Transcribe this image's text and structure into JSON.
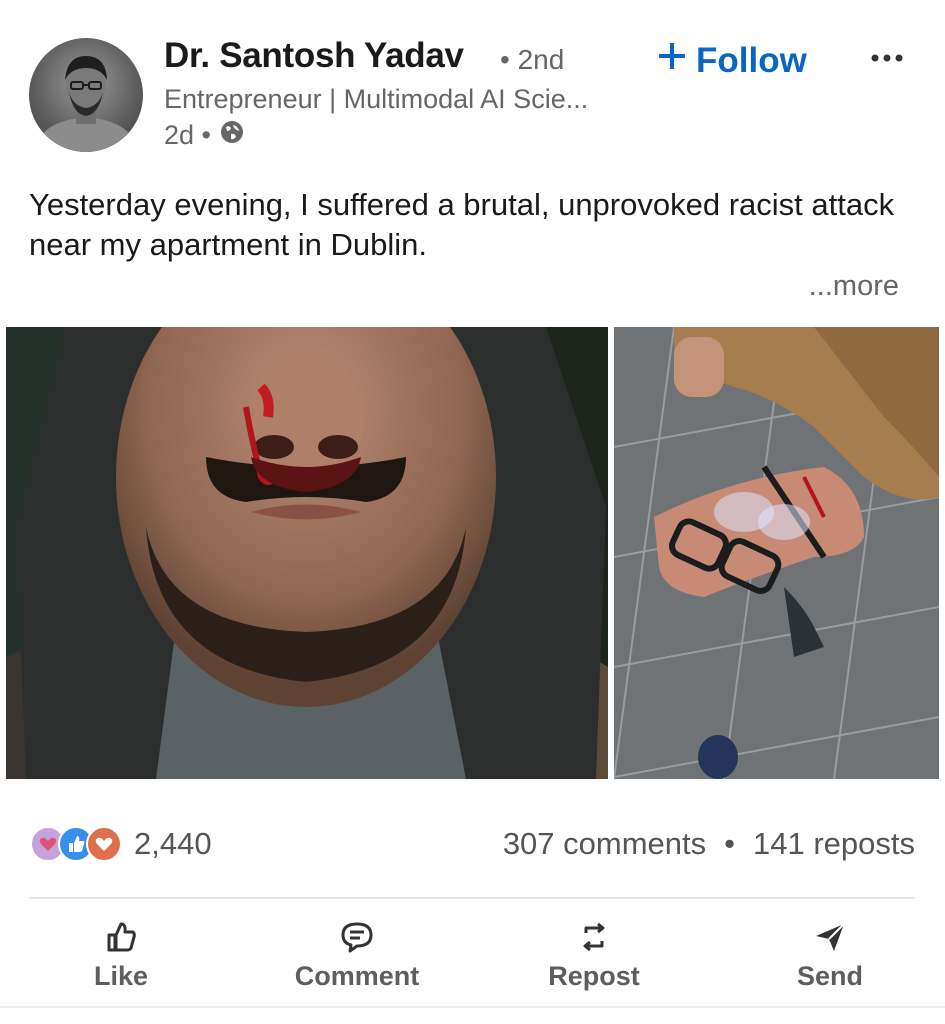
{
  "author": {
    "name": "Dr. Santosh Yadav",
    "degree": "• 2nd",
    "headline": "Entrepreneur | Multimodal AI Scie...",
    "time": "2d •",
    "visibility_icon": "globe-icon"
  },
  "follow_label": "Follow",
  "more_menu_icon": "ellipsis-icon",
  "post": {
    "text": "Yesterday evening, I suffered a brutal, unprovoked racist attack near my apartment in Dublin.",
    "see_more": "...more"
  },
  "images": [
    {
      "name": "injured-face-photo"
    },
    {
      "name": "broken-glasses-photo"
    }
  ],
  "reactions": {
    "icons": [
      "heart-hands-icon",
      "thumbs-up-icon",
      "heart-icon"
    ],
    "count": "2,440",
    "comments": "307 comments",
    "separator": "•",
    "reposts": "141 reposts"
  },
  "actions": [
    {
      "label": "Like",
      "icon": "thumbs-up-icon"
    },
    {
      "label": "Comment",
      "icon": "comment-icon"
    },
    {
      "label": "Repost",
      "icon": "repost-icon"
    },
    {
      "label": "Send",
      "icon": "send-icon"
    }
  ],
  "colors": {
    "accent": "#0a66c2",
    "text_primary": "#1a1a1a",
    "text_secondary": "#666666",
    "like_reaction": "#378fe9",
    "love_reaction": "#df704d",
    "support_reaction": "#c3a3d9"
  }
}
